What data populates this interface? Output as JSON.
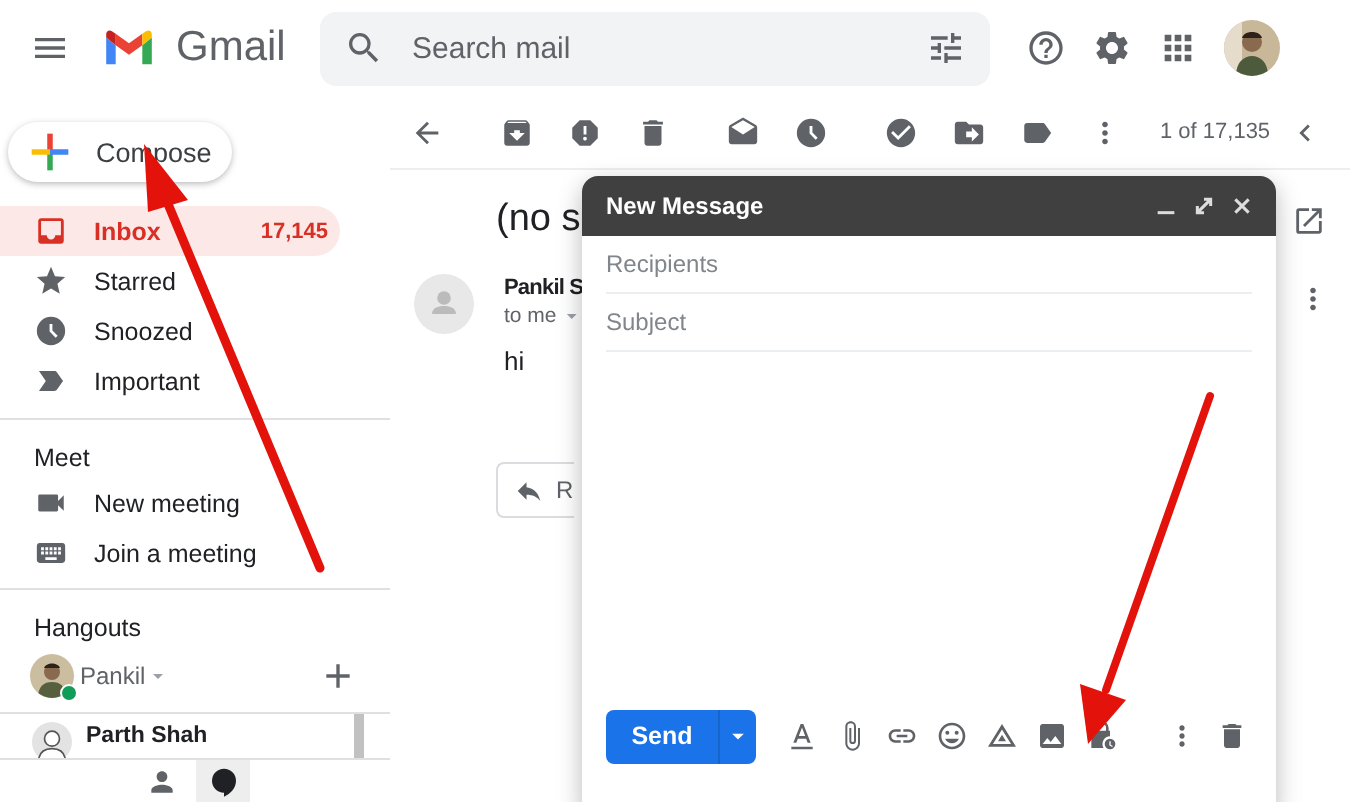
{
  "header": {
    "app_name": "Gmail",
    "search": {
      "placeholder": "Search mail"
    }
  },
  "compose_button": {
    "label": "Compose"
  },
  "nav": [
    {
      "label": "Inbox",
      "count": "17,145",
      "selected": true
    },
    {
      "label": "Starred",
      "selected": false
    },
    {
      "label": "Snoozed",
      "selected": false
    },
    {
      "label": "Important",
      "selected": false
    }
  ],
  "meet": {
    "heading": "Meet",
    "items": [
      {
        "label": "New meeting"
      },
      {
        "label": "Join a meeting"
      }
    ]
  },
  "hangouts": {
    "heading": "Hangouts",
    "user": {
      "name": "Pankil",
      "online": true
    },
    "contacts": [
      {
        "name": "Parth Shah"
      }
    ]
  },
  "toolbar": {
    "pager": "1 of 17,135"
  },
  "message": {
    "subject": "(no s",
    "sender": "Pankil S",
    "recipient": "to me",
    "body": "hi",
    "reply_label": "R"
  },
  "compose": {
    "title": "New Message",
    "recipients": {
      "placeholder": "Recipients"
    },
    "subject": {
      "placeholder": "Subject"
    },
    "send_label": "Send"
  }
}
